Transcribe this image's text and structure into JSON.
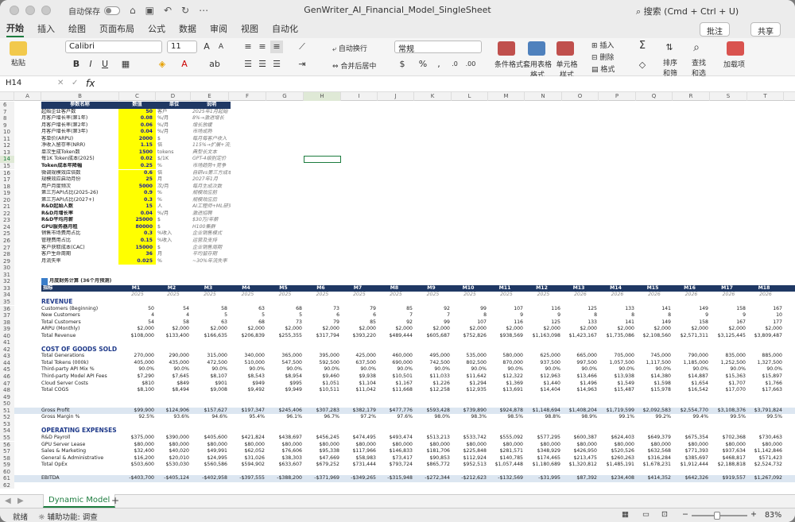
{
  "app": {
    "autosave": "自动保存",
    "title": "GenWriter_AI_Financial_Model_SingleSheet",
    "search": "搜索 (Cmd + Ctrl + U)"
  },
  "ribbon_tabs": [
    "开始",
    "插入",
    "绘图",
    "页面布局",
    "公式",
    "数据",
    "审阅",
    "视图",
    "自动化"
  ],
  "ribbon": {
    "comment": "批注",
    "share": "共享",
    "paste": "粘贴",
    "font": "Calibri",
    "size": "11",
    "wrap": "自动换行",
    "merge": "合并后居中",
    "numfmt": "常规",
    "cond": "条件格式",
    "table": "套用表格格式",
    "cellstyle": "单元格样式",
    "insert": "插入",
    "delete": "删除",
    "format": "格式",
    "sort": "排序和筛选",
    "find": "查找和选择",
    "addins": "加载项"
  },
  "formula_bar": {
    "cell": "H14",
    "fx": "fx"
  },
  "columns": [
    "A",
    "B",
    "C",
    "D",
    "E",
    "F",
    "G",
    "H",
    "I",
    "J",
    "K",
    "L",
    "M",
    "N",
    "O",
    "P",
    "Q",
    "R",
    "S",
    "T"
  ],
  "params_header": [
    "参数名称",
    "数值",
    "单位",
    "说明"
  ],
  "params": [
    [
      "起始企业客户数",
      "50",
      "客户",
      "2025年1月起始"
    ],
    [
      "月客户增长率(第1年)",
      "0.08",
      "%/月",
      "8%→激进增长"
    ],
    [
      "月客户增长率(第2年)",
      "0.06",
      "%/月",
      "增长放缓"
    ],
    [
      "月客户增长率(第3年)",
      "0.04",
      "%/月",
      "市场成熟"
    ],
    [
      "客单价(ARPU)",
      "2000",
      "$",
      "每月每客户收入"
    ],
    [
      "净收入留存率(NRR)",
      "1.15",
      "倍",
      "115%→扩展+流失"
    ],
    [
      "单次生成Token数",
      "1500",
      "tokens",
      "典型长文本"
    ],
    [
      "每1K Token成本(2025)",
      "0.02",
      "$/1K",
      "GPT-4级别定价"
    ],
    [
      "Token成本年降幅",
      "0.25",
      "%",
      "市场趋势+竞争"
    ],
    [
      "微调规模效应倍数",
      "0.6",
      "倍",
      "自研vs第三方成本"
    ],
    [
      "规模效应启动月份",
      "25",
      "月",
      "2027年1月"
    ],
    [
      "用户月度频次",
      "5000",
      "次/月",
      "每月生成次数"
    ],
    [
      "第三方API占比(2025-26)",
      "0.9",
      "%",
      "规模效应前"
    ],
    [
      "第三方API占比(2027+)",
      "0.3",
      "%",
      "规模效应后"
    ],
    [
      "R&D起始人数",
      "15",
      "人",
      "AI工程师+ML研究员"
    ],
    [
      "R&D月增长率",
      "0.04",
      "%/月",
      "激进招聘"
    ],
    [
      "R&D平均月薪",
      "25000",
      "$",
      "$30万/年薪"
    ],
    [
      "GPU服务器月租",
      "80000",
      "$",
      "H100集群"
    ],
    [
      "销售市场费用占比",
      "0.3",
      "%收入",
      "企业销售模式"
    ],
    [
      "管理费用占比",
      "0.15",
      "%收入",
      "运营及支持"
    ],
    [
      "客户获取成本(CAC)",
      "15000",
      "$",
      "企业销售周期"
    ],
    [
      "客户生命周期",
      "36",
      "月",
      "平均留存期"
    ],
    [
      "月流失率",
      "0.025",
      "%",
      "~30%年流失率"
    ]
  ],
  "model_title": "月度财务计算 (36个月预测)",
  "model_header": {
    "label": "指标",
    "months": [
      "M1",
      "M2",
      "M3",
      "M4",
      "M5",
      "M6",
      "M7",
      "M8",
      "M9",
      "M10",
      "M11",
      "M12",
      "M13",
      "M14",
      "M15",
      "M16",
      "M17",
      "M18"
    ],
    "years": [
      "2025",
      "2025",
      "2025",
      "2025",
      "2025",
      "2025",
      "2025",
      "2025",
      "2025",
      "2025",
      "2025",
      "2025",
      "2026",
      "2026",
      "2026",
      "2026",
      "2026",
      "2026"
    ]
  },
  "sections": {
    "revenue": "REVENUE",
    "cogs": "COST OF GOODS SOLD",
    "opex": "OPERATING EXPENSES"
  },
  "rows": [
    {
      "r": 36,
      "label": "Customers (Beginning)",
      "v": [
        "50",
        "54",
        "58",
        "63",
        "68",
        "73",
        "79",
        "85",
        "92",
        "99",
        "107",
        "116",
        "125",
        "133",
        "141",
        "149",
        "158",
        "167"
      ]
    },
    {
      "r": 37,
      "label": "New Customers",
      "v": [
        "4",
        "4",
        "5",
        "5",
        "5",
        "6",
        "6",
        "7",
        "7",
        "8",
        "9",
        "9",
        "8",
        "8",
        "8",
        "9",
        "9",
        "10"
      ]
    },
    {
      "r": 38,
      "label": "Total Customers",
      "v": [
        "54",
        "58",
        "63",
        "68",
        "73",
        "79",
        "85",
        "92",
        "99",
        "107",
        "116",
        "125",
        "133",
        "141",
        "149",
        "158",
        "167",
        "177"
      ]
    },
    {
      "r": 39,
      "label": "ARPU (Monthly)",
      "v": [
        "$2,000",
        "$2,000",
        "$2,000",
        "$2,000",
        "$2,000",
        "$2,000",
        "$2,000",
        "$2,000",
        "$2,000",
        "$2,000",
        "$2,000",
        "$2,000",
        "$2,000",
        "$2,000",
        "$2,000",
        "$2,000",
        "$2,000",
        "$2,000"
      ]
    },
    {
      "r": 40,
      "label": "Total Revenue",
      "v": [
        "$108,000",
        "$133,400",
        "$166,635",
        "$206,839",
        "$255,355",
        "$317,794",
        "$393,220",
        "$489,444",
        "$605,687",
        "$752,826",
        "$938,569",
        "$1,163,098",
        "$1,423,167",
        "$1,735,086",
        "$2,108,560",
        "$2,571,311",
        "$3,125,445",
        "$3,809,487"
      ]
    },
    {
      "r": 43,
      "label": "Total Generations",
      "v": [
        "270,000",
        "290,000",
        "315,000",
        "340,000",
        "365,000",
        "395,000",
        "425,000",
        "460,000",
        "495,000",
        "535,000",
        "580,000",
        "625,000",
        "665,000",
        "705,000",
        "745,000",
        "790,000",
        "835,000",
        "885,000"
      ]
    },
    {
      "r": 44,
      "label": "Total Tokens (000k)",
      "v": [
        "405,000",
        "435,000",
        "472,500",
        "510,000",
        "547,500",
        "592,500",
        "637,500",
        "690,000",
        "742,500",
        "802,500",
        "870,000",
        "937,500",
        "997,500",
        "1,057,500",
        "1,117,500",
        "1,185,000",
        "1,252,500",
        "1,327,500"
      ]
    },
    {
      "r": 45,
      "label": "Third-party API Mix %",
      "v": [
        "90.0%",
        "90.0%",
        "90.0%",
        "90.0%",
        "90.0%",
        "90.0%",
        "90.0%",
        "90.0%",
        "90.0%",
        "90.0%",
        "90.0%",
        "90.0%",
        "90.0%",
        "90.0%",
        "90.0%",
        "90.0%",
        "90.0%",
        "90.0%"
      ]
    },
    {
      "r": 46,
      "label": "Third-party Model API Fees",
      "v": [
        "$7,290",
        "$7,645",
        "$8,107",
        "$8,543",
        "$8,954",
        "$9,460",
        "$9,938",
        "$10,501",
        "$11,033",
        "$11,642",
        "$12,322",
        "$12,963",
        "$13,466",
        "$13,938",
        "$14,380",
        "$14,887",
        "$15,363",
        "$15,897"
      ]
    },
    {
      "r": 47,
      "label": "Cloud Server Costs",
      "v": [
        "$810",
        "$849",
        "$901",
        "$949",
        "$995",
        "$1,051",
        "$1,104",
        "$1,167",
        "$1,226",
        "$1,294",
        "$1,369",
        "$1,440",
        "$1,496",
        "$1,549",
        "$1,598",
        "$1,654",
        "$1,707",
        "$1,766"
      ]
    },
    {
      "r": 48,
      "label": "Total COGS",
      "v": [
        "$8,100",
        "$8,494",
        "$9,008",
        "$9,492",
        "$9,949",
        "$10,511",
        "$11,042",
        "$11,668",
        "$12,258",
        "$12,935",
        "$13,691",
        "$14,404",
        "$14,963",
        "$15,487",
        "$15,978",
        "$16,542",
        "$17,070",
        "$17,663"
      ]
    },
    {
      "r": 51,
      "label": "Gross Profit",
      "v": [
        "$99,900",
        "$124,906",
        "$157,627",
        "$197,347",
        "$245,406",
        "$307,283",
        "$382,179",
        "$477,776",
        "$593,428",
        "$739,890",
        "$924,878",
        "$1,148,694",
        "$1,408,204",
        "$1,719,599",
        "$2,092,583",
        "$2,554,770",
        "$3,108,376",
        "$3,791,824"
      ]
    },
    {
      "r": 52,
      "label": "Gross Margin %",
      "v": [
        "92.5%",
        "93.6%",
        "94.6%",
        "95.4%",
        "96.1%",
        "96.7%",
        "97.2%",
        "97.6%",
        "98.0%",
        "98.3%",
        "98.5%",
        "98.8%",
        "98.9%",
        "99.1%",
        "99.2%",
        "99.4%",
        "99.5%",
        "99.5%"
      ]
    },
    {
      "r": 55,
      "label": "R&D Payroll",
      "v": [
        "$375,000",
        "$390,000",
        "$405,600",
        "$421,824",
        "$438,697",
        "$456,245",
        "$474,495",
        "$493,474",
        "$513,213",
        "$533,742",
        "$555,092",
        "$577,295",
        "$600,387",
        "$624,403",
        "$649,379",
        "$675,354",
        "$702,368",
        "$730,463"
      ]
    },
    {
      "r": 56,
      "label": "GPU Server Lease",
      "v": [
        "$80,000",
        "$80,000",
        "$80,000",
        "$80,000",
        "$80,000",
        "$80,000",
        "$80,000",
        "$80,000",
        "$80,000",
        "$80,000",
        "$80,000",
        "$80,000",
        "$80,000",
        "$80,000",
        "$80,000",
        "$80,000",
        "$80,000",
        "$80,000"
      ]
    },
    {
      "r": 57,
      "label": "Sales & Marketing",
      "v": [
        "$32,400",
        "$40,020",
        "$49,991",
        "$62,052",
        "$76,606",
        "$95,338",
        "$117,966",
        "$146,833",
        "$181,706",
        "$225,848",
        "$281,571",
        "$348,929",
        "$426,950",
        "$520,526",
        "$632,568",
        "$771,393",
        "$937,634",
        "$1,142,846"
      ]
    },
    {
      "r": 58,
      "label": "General & Administrative",
      "v": [
        "$16,200",
        "$20,010",
        "$24,995",
        "$31,026",
        "$38,303",
        "$47,669",
        "$58,983",
        "$73,417",
        "$90,853",
        "$112,924",
        "$140,785",
        "$174,465",
        "$213,475",
        "$260,263",
        "$316,284",
        "$385,697",
        "$468,817",
        "$571,423"
      ]
    },
    {
      "r": 59,
      "label": "Total OpEx",
      "v": [
        "$503,600",
        "$530,030",
        "$560,586",
        "$594,902",
        "$633,607",
        "$679,252",
        "$731,444",
        "$793,724",
        "$865,772",
        "$952,513",
        "$1,057,448",
        "$1,180,689",
        "$1,320,812",
        "$1,485,191",
        "$1,678,231",
        "$1,912,444",
        "$2,188,818",
        "$2,524,732"
      ]
    },
    {
      "r": 61,
      "label": "EBITDA",
      "v": [
        "-$403,700",
        "-$405,124",
        "-$402,958",
        "-$397,555",
        "-$388,200",
        "-$371,969",
        "-$349,265",
        "-$315,948",
        "-$272,344",
        "-$212,623",
        "-$132,569",
        "-$31,995",
        "$87,392",
        "$234,408",
        "$414,352",
        "$642,326",
        "$919,557",
        "$1,267,092"
      ]
    }
  ],
  "sheet_tab": "Dynamic Model",
  "status": {
    "ready": "就绪",
    "access": "辅助功能: 调查",
    "zoom": "83%"
  }
}
